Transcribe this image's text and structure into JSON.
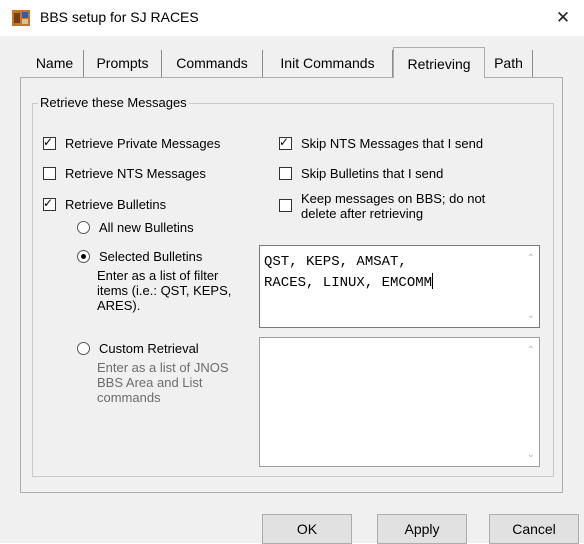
{
  "window": {
    "title": "BBS setup for SJ RACES",
    "close_glyph": "✕"
  },
  "tabs": [
    {
      "label": "Name"
    },
    {
      "label": "Prompts"
    },
    {
      "label": "Commands"
    },
    {
      "label": "Init Commands"
    },
    {
      "label": "Retrieving",
      "active": true
    },
    {
      "label": "Path"
    }
  ],
  "group": {
    "label": "Retrieve these Messages"
  },
  "options": {
    "private": {
      "label": "Retrieve Private Messages",
      "checked": true
    },
    "nts": {
      "label": "Retrieve NTS Messages",
      "checked": false
    },
    "bulletins": {
      "label": "Retrieve Bulletins",
      "checked": true
    },
    "skip_nts": {
      "label": "Skip NTS Messages that I send",
      "checked": true
    },
    "skip_bulletins": {
      "label": "Skip Bulletins that I send",
      "checked": false
    },
    "keep": {
      "label_line1": "Keep messages on BBS; do not",
      "label_line2": "delete after retrieving",
      "checked": false
    }
  },
  "bulletin_modes": {
    "all_new": {
      "label": "All new Bulletins",
      "selected": false
    },
    "selected": {
      "label": "Selected Bulletins",
      "selected": true,
      "help_line1": "Enter as a list of filter",
      "help_line2": "items (i.e.: QST, KEPS,",
      "help_line3": "ARES)."
    },
    "custom": {
      "label": "Custom Retrieval",
      "selected": false,
      "help_line1": "Enter as a list of JNOS",
      "help_line2": "BBS Area and List",
      "help_line3": "commands"
    }
  },
  "selected_text": {
    "line1": "QST, KEPS, AMSAT,",
    "line2": "RACES, LINUX, EMCOMM"
  },
  "custom_text": "",
  "scroll": {
    "up": "⌃",
    "down": "⌄"
  },
  "buttons": {
    "ok": "OK",
    "apply": "Apply",
    "cancel": "Cancel"
  }
}
